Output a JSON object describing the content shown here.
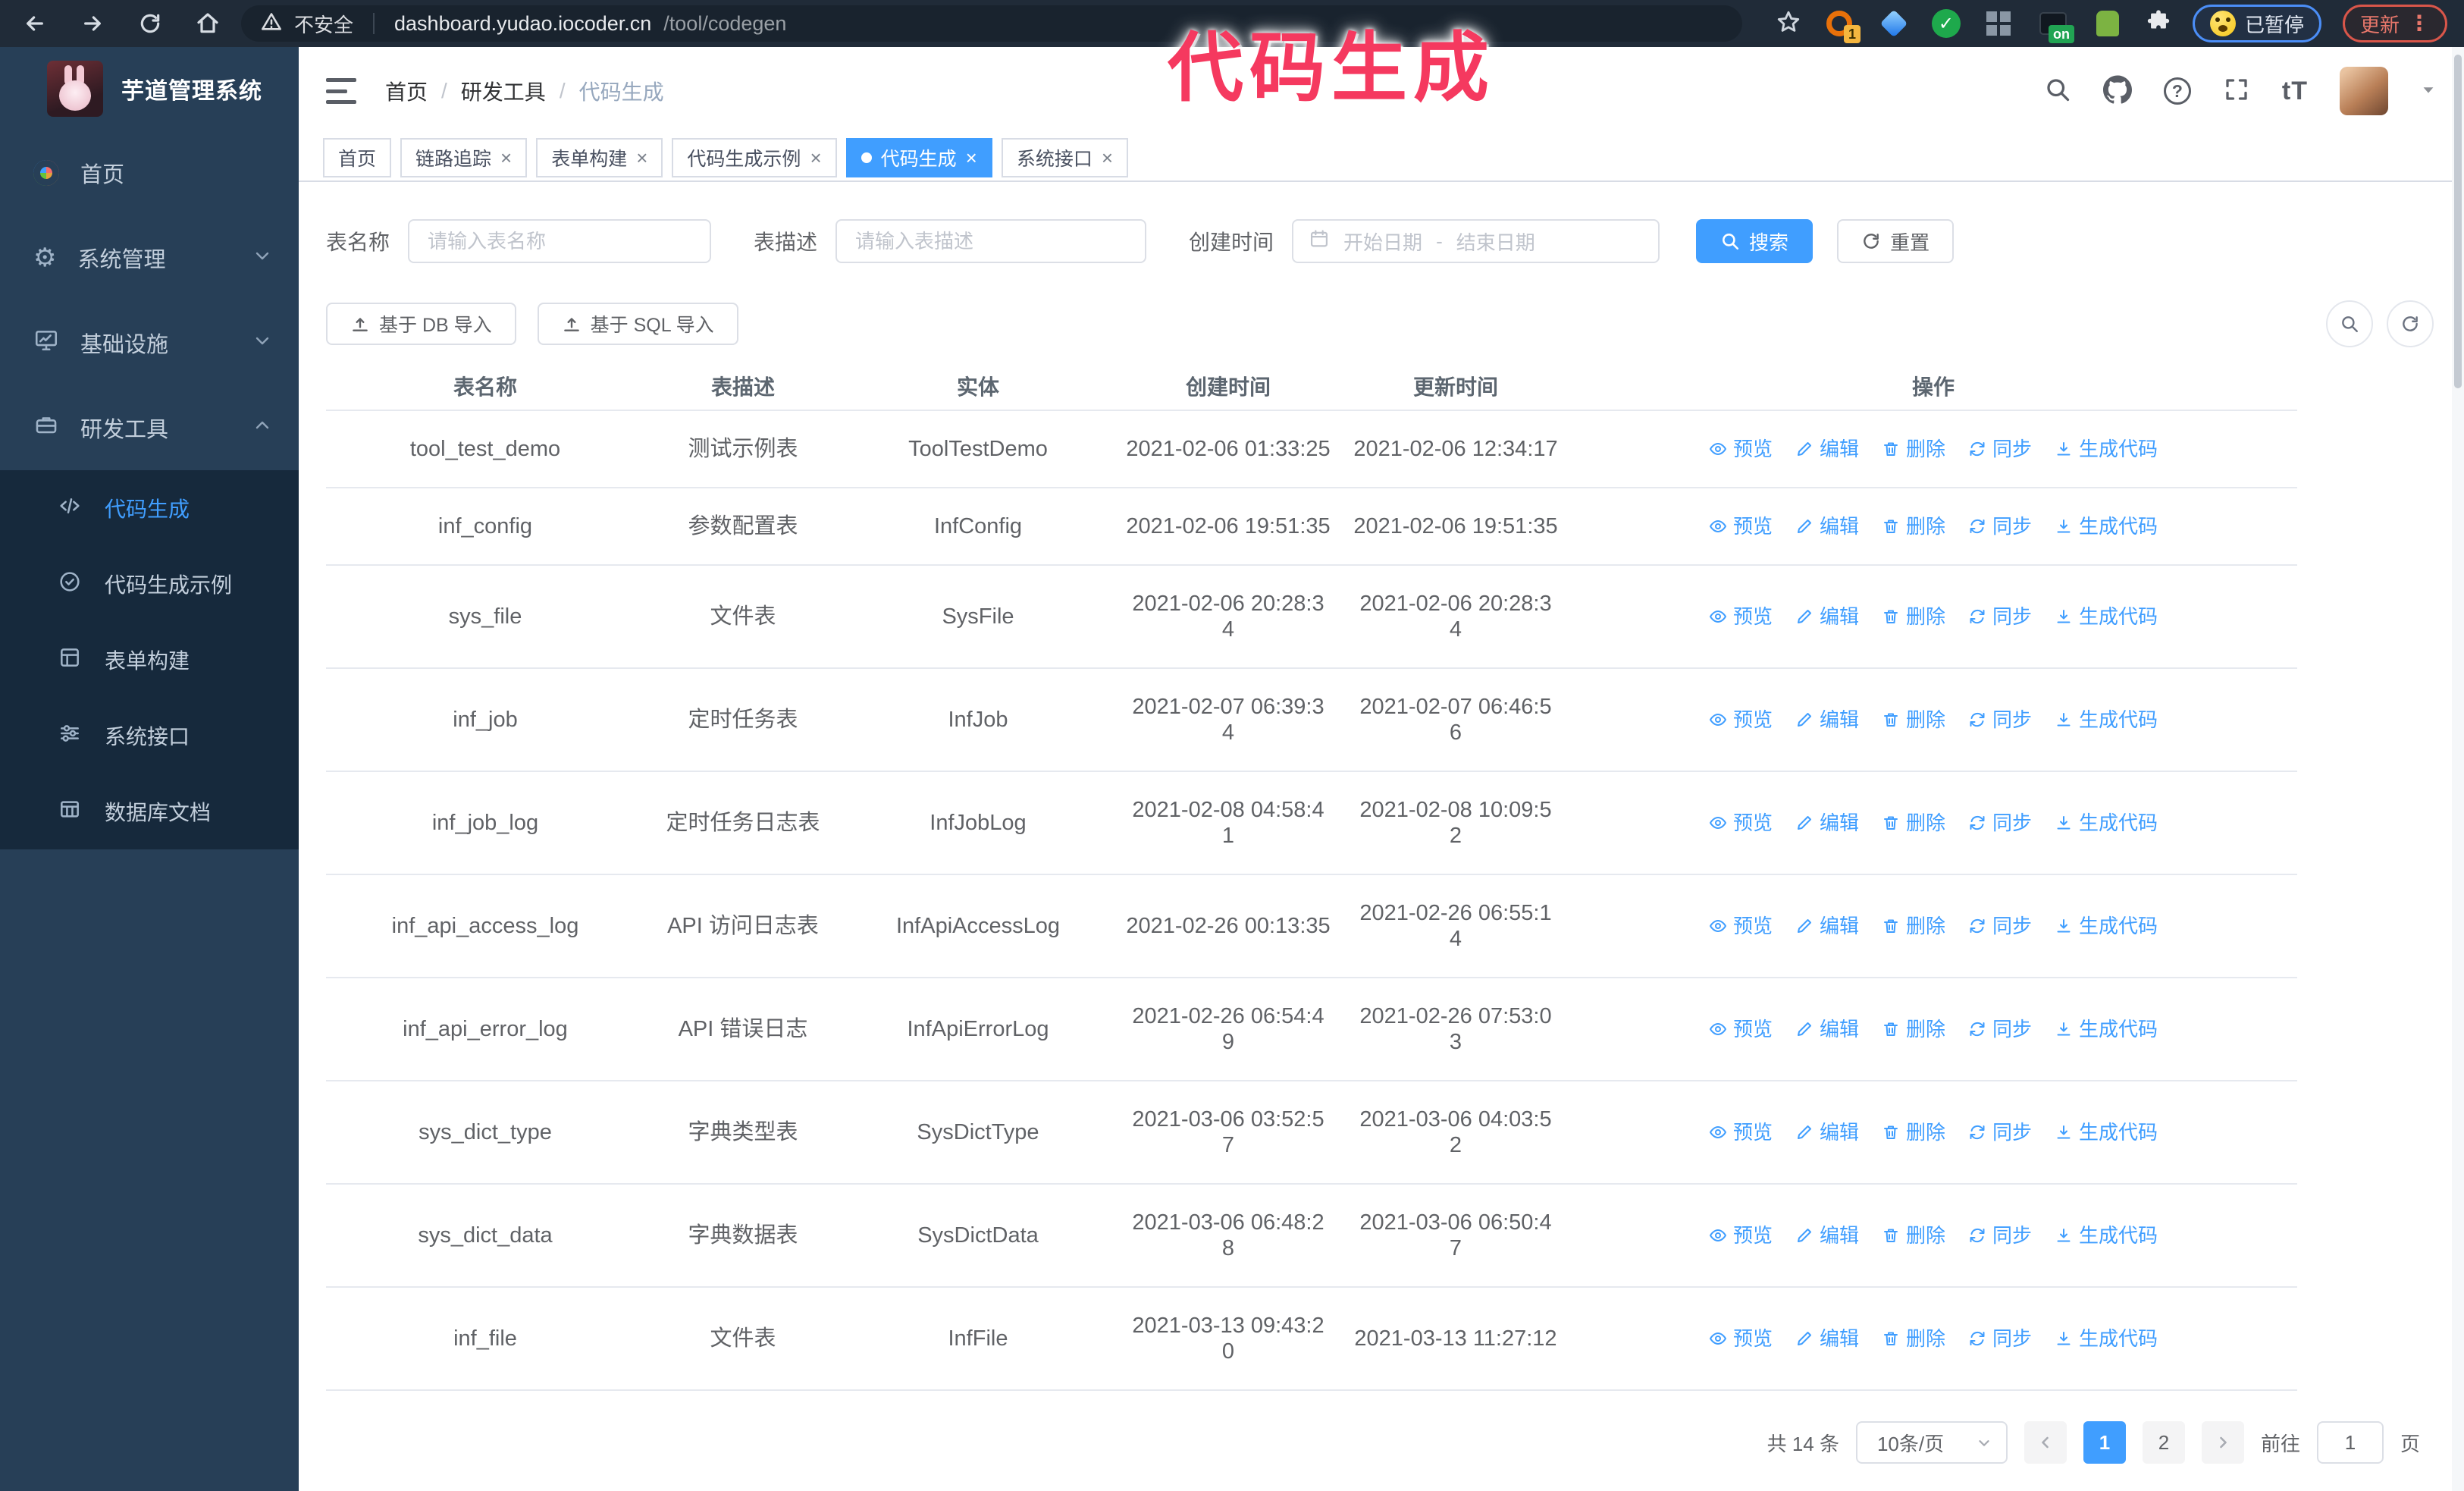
{
  "browser": {
    "security_label": "不安全",
    "url_host": "dashboard.yudao.iocoder.cn",
    "url_path": "/tool/codegen",
    "ext_badge_1": "1",
    "ext_badge_on": "on",
    "paused_badge": "已暂停",
    "update_badge": "更新"
  },
  "overlay": {
    "text": "代码生成",
    "color": "#f5395f"
  },
  "icons": {
    "separator": "/",
    "close": "×",
    "check": "✓",
    "gear": "⚙",
    "kebab": "⋮"
  },
  "sidebar": {
    "title": "芋道管理系统",
    "items": [
      {
        "label": "首页"
      },
      {
        "label": "系统管理"
      },
      {
        "label": "基础设施"
      },
      {
        "label": "研发工具"
      }
    ],
    "submenu": [
      {
        "label": "代码生成"
      },
      {
        "label": "代码生成示例"
      },
      {
        "label": "表单构建"
      },
      {
        "label": "系统接口"
      },
      {
        "label": "数据库文档"
      }
    ]
  },
  "header": {
    "breadcrumb": [
      "首页",
      "研发工具",
      "代码生成"
    ]
  },
  "tabs": [
    {
      "label": "首页"
    },
    {
      "label": "链路追踪"
    },
    {
      "label": "表单构建"
    },
    {
      "label": "代码生成示例"
    },
    {
      "label": "代码生成"
    },
    {
      "label": "系统接口"
    }
  ],
  "filters": {
    "table_name_label": "表名称",
    "table_name_placeholder": "请输入表名称",
    "table_desc_label": "表描述",
    "table_desc_placeholder": "请输入表描述",
    "create_time_label": "创建时间",
    "date_start_placeholder": "开始日期",
    "date_separator": "-",
    "date_end_placeholder": "结束日期",
    "search_label": "搜索",
    "reset_label": "重置"
  },
  "toolbar": {
    "import_db_label": "基于 DB 导入",
    "import_sql_label": "基于 SQL 导入"
  },
  "table": {
    "columns": [
      "表名称",
      "表描述",
      "实体",
      "创建时间",
      "更新时间",
      "操作"
    ],
    "actions": [
      "预览",
      "编辑",
      "删除",
      "同步",
      "生成代码"
    ],
    "rows": [
      {
        "name": "tool_test_demo",
        "desc": "测试示例表",
        "entity": "ToolTestDemo",
        "created": "2021-02-06 01:33:25",
        "updated": "2021-02-06 12:34:17"
      },
      {
        "name": "inf_config",
        "desc": "参数配置表",
        "entity": "InfConfig",
        "created": "2021-02-06 19:51:35",
        "updated": "2021-02-06 19:51:35"
      },
      {
        "name": "sys_file",
        "desc": "文件表",
        "entity": "SysFile",
        "created": "2021-02-06 20:28:3\n4",
        "updated": "2021-02-06 20:28:3\n4"
      },
      {
        "name": "inf_job",
        "desc": "定时任务表",
        "entity": "InfJob",
        "created": "2021-02-07 06:39:3\n4",
        "updated": "2021-02-07 06:46:5\n6"
      },
      {
        "name": "inf_job_log",
        "desc": "定时任务日志表",
        "entity": "InfJobLog",
        "created": "2021-02-08 04:58:4\n1",
        "updated": "2021-02-08 10:09:5\n2"
      },
      {
        "name": "inf_api_access_log",
        "desc": "API 访问日志表",
        "entity": "InfApiAccessLog",
        "created": "2021-02-26 00:13:35",
        "updated": "2021-02-26 06:55:1\n4"
      },
      {
        "name": "inf_api_error_log",
        "desc": "API 错误日志",
        "entity": "InfApiErrorLog",
        "created": "2021-02-26 06:54:4\n9",
        "updated": "2021-02-26 07:53:0\n3"
      },
      {
        "name": "sys_dict_type",
        "desc": "字典类型表",
        "entity": "SysDictType",
        "created": "2021-03-06 03:52:5\n7",
        "updated": "2021-03-06 04:03:5\n2"
      },
      {
        "name": "sys_dict_data",
        "desc": "字典数据表",
        "entity": "SysDictData",
        "created": "2021-03-06 06:48:2\n8",
        "updated": "2021-03-06 06:50:4\n7"
      },
      {
        "name": "inf_file",
        "desc": "文件表",
        "entity": "InfFile",
        "created": "2021-03-13 09:43:2\n0",
        "updated": "2021-03-13 11:27:12"
      }
    ]
  },
  "pagination": {
    "total_label": "共 14 条",
    "page_size": "10条/页",
    "pages": [
      "1",
      "2"
    ],
    "active_page": "1",
    "goto_label": "前往",
    "goto_value": "1",
    "goto_suffix": "页"
  },
  "colors": {
    "primary": "#409eff",
    "sidebar_bg": "#273f57",
    "submenu_bg": "#16293c",
    "overlay_pink": "#f5395f"
  }
}
